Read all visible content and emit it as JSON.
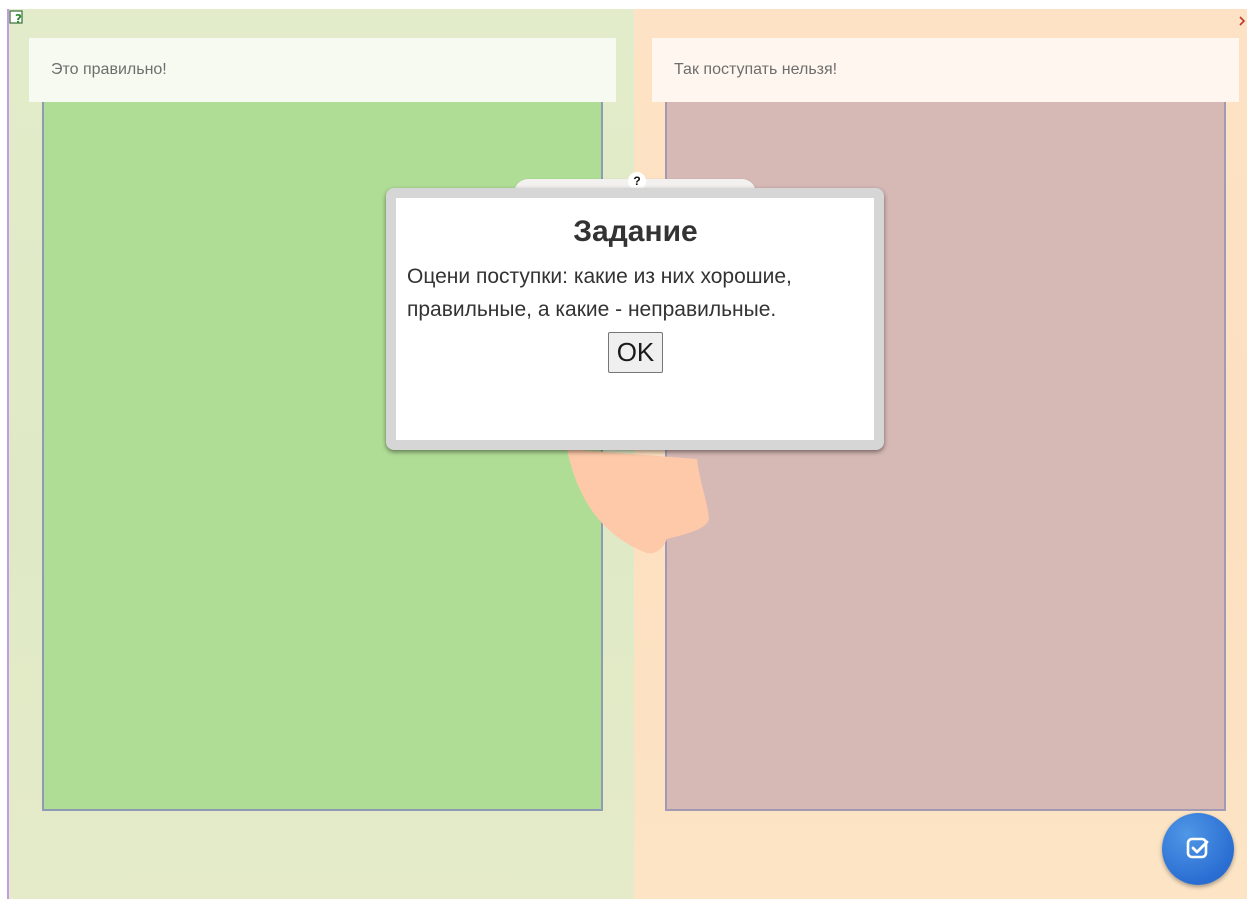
{
  "categories": {
    "left_label": "Это правильно!",
    "right_label": "Так поступать нельзя!"
  },
  "card": {
    "help_badge": "?"
  },
  "dialog": {
    "title": "Задание",
    "text": "Оцени поступки: какие из них хорошие, правильные, а какие - неправильные.",
    "ok_label": "OK"
  },
  "icons": {
    "top_left": "help-window-icon",
    "top_right": "close-icon",
    "check": "check-square-icon"
  },
  "colors": {
    "left_bin": "#afdd95",
    "right_bin": "#d6b8b5",
    "check_button": "#2b6ed3"
  }
}
